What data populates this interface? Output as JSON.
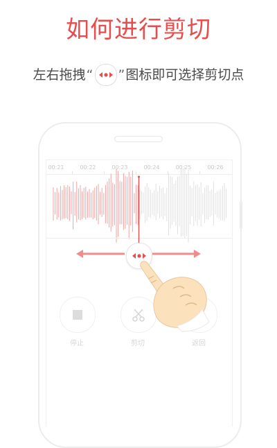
{
  "header": {
    "title": "如何进行剪切",
    "instruction_before": "左右拖拽",
    "quote_open": "“",
    "quote_close": "”",
    "instruction_after": "图标即可选择剪切点"
  },
  "timeline": {
    "ticks": [
      "00:21",
      "00:22",
      "00:23",
      "00:24",
      "00:25",
      "00:26"
    ]
  },
  "controls": {
    "stop_label": "停止",
    "cut_label": "剪切",
    "back_label": "返回"
  },
  "colors": {
    "accent": "#e84c4c",
    "waveform_selected": "#f4a3a3",
    "waveform_unselected": "#e0e0e0",
    "arrow": "#f08c8c"
  },
  "icons": {
    "handle": "double-arrow-dot-icon",
    "stop": "stop-icon",
    "cut": "scissors-icon",
    "back": "return-icon",
    "gesture": "pointing-hand-icon"
  }
}
